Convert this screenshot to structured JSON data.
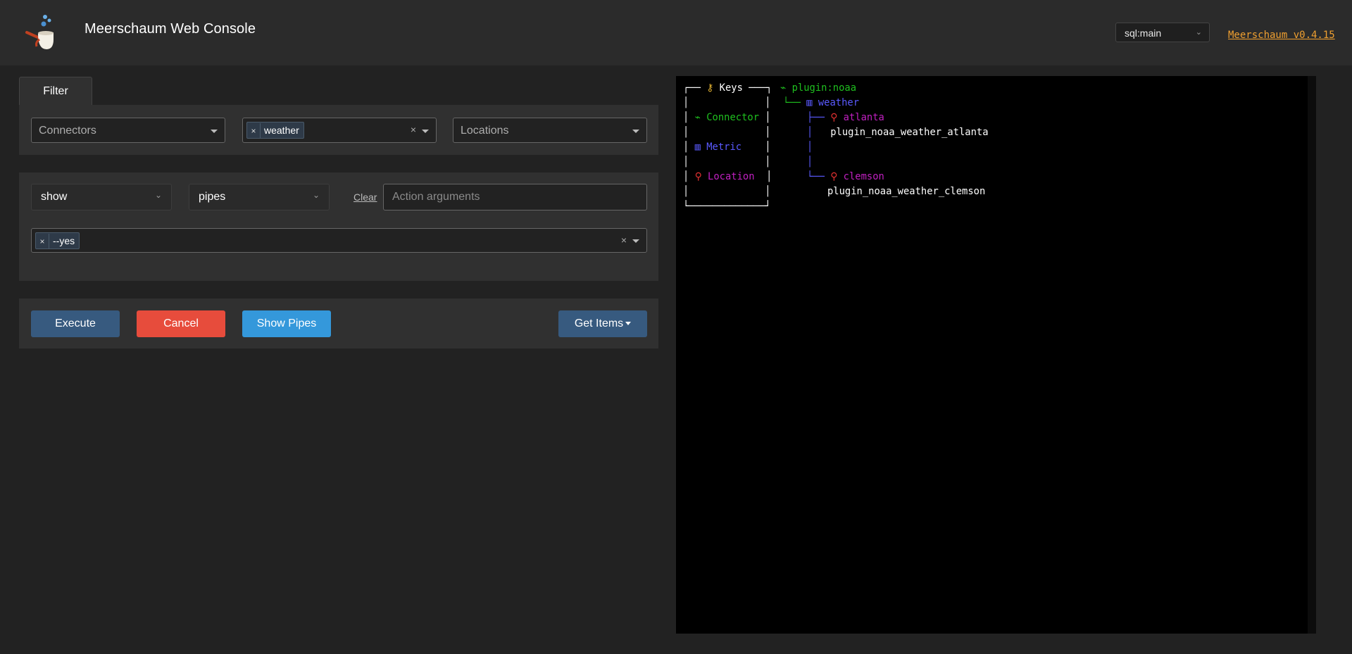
{
  "header": {
    "title": "Meerschaum Web Console",
    "instance": "sql:main",
    "version": "Meerschaum v0.4.15"
  },
  "filter": {
    "tab_label": "Filter",
    "connectors_placeholder": "Connectors",
    "metrics_selected": "weather",
    "locations_placeholder": "Locations"
  },
  "action": {
    "action_value": "show",
    "subaction_value": "pipes",
    "clear_label": "Clear",
    "args_placeholder": "Action arguments",
    "flag_selected": "--yes"
  },
  "buttons": {
    "execute": "Execute",
    "cancel": "Cancel",
    "show_pipes": "Show Pipes",
    "get_items": "Get Items"
  },
  "terminal": {
    "legend_title": "Keys",
    "legend_connector": "Connector",
    "legend_metric": "Metric",
    "legend_location": "Location",
    "connector": "plugin:noaa",
    "metric": "weather",
    "location_1": "atlanta",
    "pipe_1": "plugin_noaa_weather_atlanta",
    "location_2": "clemson",
    "pipe_2": "plugin_noaa_weather_clemson"
  },
  "colors": {
    "connector": "#1fc01f",
    "metric": "#5a5aff",
    "location": "#c020c0",
    "execute": "#375a7f",
    "cancel": "#e74c3c",
    "show_pipes": "#3498db",
    "version_link": "#f0a030"
  },
  "icons": {
    "connector": "plug-icon",
    "metric": "bar-chart-icon",
    "location": "pin-icon",
    "keys": "key-icon"
  }
}
